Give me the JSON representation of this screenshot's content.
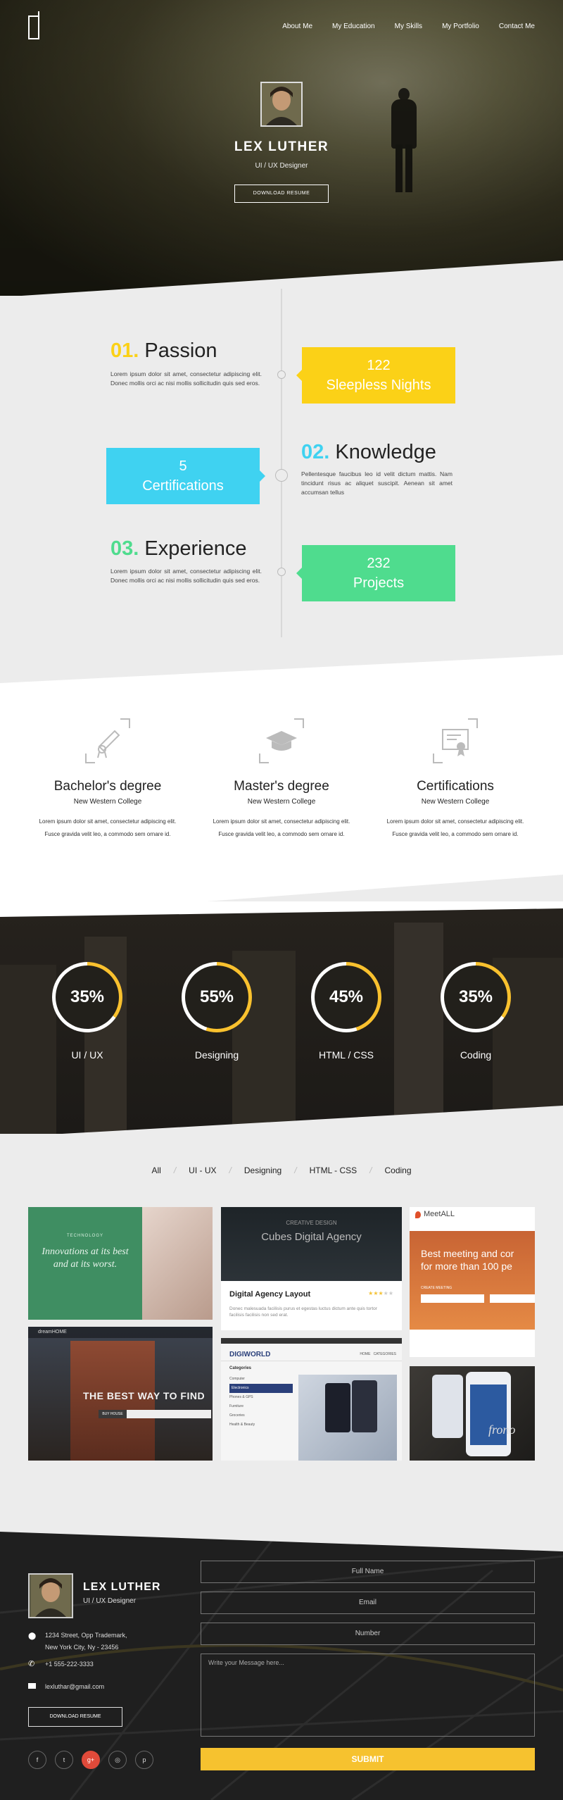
{
  "nav": {
    "items": [
      "About Me",
      "My Education",
      "My Skills",
      "My Portfolio",
      "Contact Me"
    ]
  },
  "hero": {
    "name": "LEX LUTHER",
    "role": "UI / UX Designer",
    "button": "DOWNLOAD RESUME"
  },
  "timeline": [
    {
      "num": "01.",
      "title": "Passion",
      "text": "Lorem ipsum dolor sit amet, consectetur adipiscing elit. Donec mollis orci ac nisi mollis sollicitudin quis sed eros.",
      "box_number": "122",
      "box_label": "Sleepless Nights",
      "box_color": "#fbd117",
      "num_color": "#fbd117"
    },
    {
      "num": "02.",
      "title": "Knowledge",
      "text": "Pellentesque faucibus leo id velit dictum mattis. Nam tincidunt risus ac aliquet suscipit. Aenean sit amet accumsan tellus",
      "box_number": "5",
      "box_label": "Certifications",
      "box_color": "#3fd2f1",
      "num_color": "#3fd2f1"
    },
    {
      "num": "03.",
      "title": "Experience",
      "text": "Lorem ipsum dolor sit amet, consectetur adipiscing elit. Donec mollis orci ac nisi mollis sollicitudin quis sed eros.",
      "box_number": "232",
      "box_label": "Projects",
      "box_color": "#4fdc8e",
      "num_color": "#4fdc8e"
    }
  ],
  "education": [
    {
      "title": "Bachelor's degree",
      "school": "New Western College",
      "line1": "Lorem ipsum dolor sit amet, consectetur adipiscing elit.",
      "line2": "Fusce gravida velit leo, a commodo sem ornare id.",
      "icon": "diploma-icon"
    },
    {
      "title": "Master's degree",
      "school": "New Western College",
      "line1": "Lorem ipsum dolor sit amet, consectetur adipiscing elit.",
      "line2": "Fusce gravida velit leo, a commodo sem ornare id.",
      "icon": "graduation-cap-icon"
    },
    {
      "title": "Certifications",
      "school": "New Western College",
      "line1": "Lorem ipsum dolor sit amet, consectetur adipiscing elit.",
      "line2": "Fusce gravida velit leo, a commodo sem ornare id.",
      "icon": "certificate-icon"
    }
  ],
  "skills": [
    {
      "label": "UI / UX",
      "percent": 35,
      "text": "35%"
    },
    {
      "label": "Designing",
      "percent": 55,
      "text": "55%"
    },
    {
      "label": "HTML / CSS",
      "percent": 45,
      "text": "45%"
    },
    {
      "label": "Coding",
      "percent": 35,
      "text": "35%"
    }
  ],
  "skill_color": "#f9c12e",
  "filters": [
    "All",
    "UI - UX",
    "Designing",
    "HTML - CSS",
    "Coding"
  ],
  "portfolio": {
    "p1_tag": "TECHNOLOGY",
    "p1_text1": "Innovations at its best",
    "p1_text2": "and at its worst.",
    "p2_brand": "dreamHOME",
    "p2_text": "THE BEST WAY TO FIND",
    "p2_btn": "BUY HOUSE",
    "p3_tag": "CREATIVE DESIGN",
    "p3_title": "Cubes Digital Agency",
    "p3_card_title": "Digital Agency Layout",
    "p3_card_text": "Donec malesuada facilisis purus et egestas luctus dictum ante quis tortor facilisis facilisis non sed erat.",
    "p4_brand": "DIGIWORLD",
    "p4_nav": "HOME   CATEGORIES",
    "p4_cat": "Categories",
    "p4_items": [
      "Computer",
      "Electronics",
      "Phones & GPS",
      "Furniture",
      "Groceries",
      "Health & Beauty"
    ],
    "p5_brand": "MeetALL",
    "p5_text1": "Best meeting and cor",
    "p5_text2": "for more than 100 pe",
    "p5_btn": "CREATE MEETING",
    "p6_brand": "frono"
  },
  "footer": {
    "name": "LEX LUTHER",
    "role": "UI / UX Designer",
    "address1": "1234 Street, Opp Trademark,",
    "address2": "New York City, Ny - 23456",
    "phone": "+1 555-222-3333",
    "email": "lexluthar@gmail.com",
    "button": "DOWNLOAD RESUME",
    "form": {
      "name": "Full Name",
      "email": "Email",
      "number": "Number",
      "message": "Write your Message here...",
      "submit": "SUBMIT"
    },
    "social": [
      "f",
      "t",
      "g+",
      "◎",
      "p"
    ]
  }
}
